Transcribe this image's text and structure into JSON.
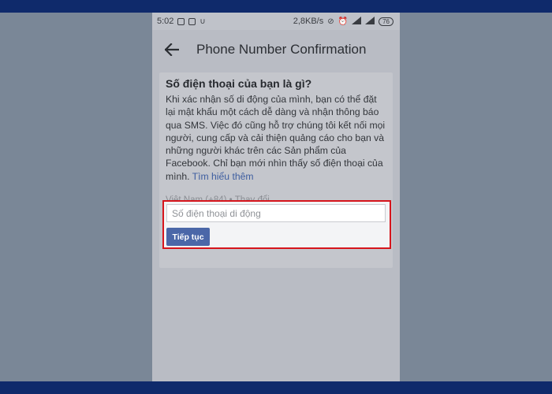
{
  "status_bar": {
    "time": "5:02",
    "net_speed": "2,8KB/s",
    "battery": "76",
    "icons_left": [
      "notification-icon",
      "image-icon",
      "u-icon"
    ],
    "icons_right": [
      "no-alarm-icon",
      "alarm-icon",
      "signal-icon",
      "signal-icon",
      "battery-icon"
    ]
  },
  "app_bar": {
    "back_icon": "arrow-left-icon",
    "title": "Phone Number Confirmation"
  },
  "content": {
    "question": "Số điện thoại của bạn là gì?",
    "description": "Khi xác nhận số di động của mình, bạn có thể đặt lại mật khẩu một cách dễ dàng và nhận thông báo qua SMS. Việc đó cũng hỗ trợ chúng tôi kết nối mọi người, cung cấp và cải thiện quảng cáo cho bạn và những người khác trên các Sản phẩm của Facebook. Chỉ bạn mới nhìn thấy số điện thoại của mình.",
    "learn_more": "Tìm hiểu thêm",
    "country": "Việt Nam (+84)",
    "separator": "•",
    "change": "Thay đổi"
  },
  "form": {
    "phone_placeholder": "Số điện thoại di động",
    "phone_value": "",
    "continue_label": "Tiếp tục"
  },
  "colors": {
    "highlight_border": "#d6151c",
    "button": "#4b67a8",
    "frame_band": "#0f2a6b"
  }
}
